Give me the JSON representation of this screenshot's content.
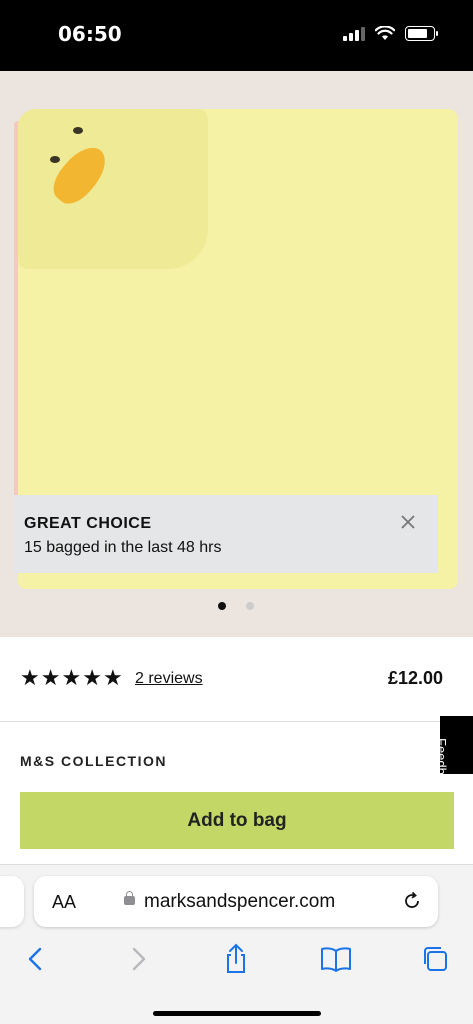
{
  "status_bar": {
    "time": "06:50",
    "battery_level": 0.8
  },
  "promo_toast": {
    "title": "GREAT CHOICE",
    "message": "15 bagged in the last 48 hrs",
    "close_icon": "close-icon"
  },
  "carousel": {
    "total": 2,
    "active_index": 0
  },
  "product": {
    "rating": 5,
    "max_rating": 5,
    "reviews_label": "2 reviews",
    "price": "£12.00",
    "brand": "M&S COLLECTION",
    "add_to_bag_label": "Add to bag"
  },
  "feedback_tab": {
    "label": "Feedback"
  },
  "browser": {
    "aa_label": "AA",
    "url": "marksandspencer.com",
    "icons": [
      "back-icon",
      "forward-icon",
      "share-icon",
      "bookmarks-icon",
      "tabs-icon"
    ]
  },
  "colors": {
    "accent": "#c2d766",
    "ios_blue": "#1a73e8",
    "towel_yellow": "#f5f2a6",
    "beak_orange": "#f2b631"
  }
}
